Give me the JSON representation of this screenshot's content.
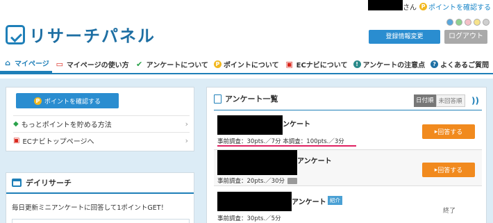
{
  "top": {
    "san": "さん",
    "check_points": "ポイントを確認する"
  },
  "logo": {
    "text": "リサーチパネル"
  },
  "header": {
    "register_btn": "登録情報変更",
    "logout_btn": "ログアウト",
    "theme_dots": [
      "#5aa7dc",
      "#8fd18f",
      "#f5c0c8",
      "#f7e38a",
      "#cfcfcf"
    ]
  },
  "nav": {
    "items": [
      {
        "label": "マイページ",
        "icon": "home-icon"
      },
      {
        "label": "マイページの使い方",
        "icon": "monitor-icon"
      },
      {
        "label": "アンケートについて",
        "icon": "check-icon"
      },
      {
        "label": "ポイントについて",
        "icon": "coin-icon"
      },
      {
        "label": "ECナビについて",
        "icon": "gift-icon"
      },
      {
        "label": "アンケートの注意点",
        "icon": "exclamation-icon"
      },
      {
        "label": "よくあるご質問",
        "icon": "question-icon"
      }
    ]
  },
  "left": {
    "points_btn": "ポイントを確認する",
    "links": [
      {
        "label": "もっとポイントを貯める方法",
        "icon": "beginner-icon"
      },
      {
        "label": "ECナビトップページへ",
        "icon": "gift-icon"
      }
    ],
    "daily": {
      "title": "デイリサーチ",
      "body": "毎日更新ミニアンケートに回答して1ポイントGET！"
    }
  },
  "survey": {
    "title": "アンケート一覧",
    "sort_on": "日付順",
    "sort_off": "未回答順",
    "items": [
      {
        "title": "ンケート",
        "sub": "事前調査：30pts.／7分 本調査：100pts.／3分",
        "action": "回答する"
      },
      {
        "title": "アンケート",
        "sub": "事前調査：20pts.／30分",
        "action": "回答する"
      },
      {
        "title": "アンケート",
        "badge": "紹介",
        "sub": "事前調査：30pts.／5分",
        "status": "終了"
      }
    ]
  },
  "colors": {
    "accent": "#1e7fb8",
    "button_blue": "#2a8dd0",
    "answer_orange": "#f18a1e",
    "background_panel": "#dcecf6"
  }
}
